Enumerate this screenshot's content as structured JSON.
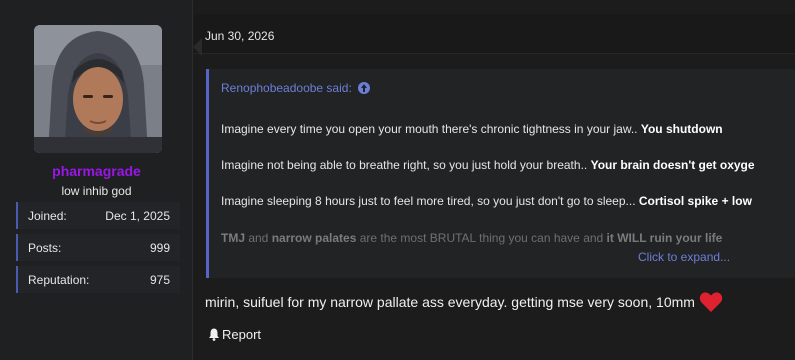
{
  "post": {
    "date": "Jun 30, 2026",
    "message": "mirin, suifuel for my narrow pallate ass everyday. getting mse very soon, 10mm",
    "emoji_icon": "red-heart-icon",
    "report_label": "Report",
    "report_icon": "bell-icon"
  },
  "user": {
    "username": "pharmagrade",
    "username_color": "#9b16e6",
    "title": "low inhib god",
    "stats": [
      {
        "label": "Joined:",
        "value": "Dec 1, 2025"
      },
      {
        "label": "Posts:",
        "value": "999"
      },
      {
        "label": "Reputation:",
        "value": "975"
      }
    ]
  },
  "quote": {
    "author_said": "Renophobeadoobe said:",
    "lines": [
      {
        "text": "Imagine every time you open your mouth there's chronic tightness in your jaw.. ",
        "bold": "You shutdown"
      },
      {
        "text": "Imagine not being able to breathe right, so you just hold your breath.. ",
        "bold": "Your brain doesn't get oxyge"
      },
      {
        "text": "Imagine sleeping 8 hours just to feel more tired, so you just don't go to sleep... ",
        "bold": "Cortisol spike + low"
      }
    ],
    "last_line": {
      "b1": "TMJ",
      "t1": " and ",
      "b2": "narrow palates",
      "t2": " are the most BRUTAL thing you can have and ",
      "b3": "it WILL ruin your life"
    },
    "expand_label": "Click to expand..."
  },
  "colors": {
    "accent": "#5665c7",
    "link": "#6c7fd7",
    "heart": "#e0212f",
    "background": "#1c1c1c"
  }
}
